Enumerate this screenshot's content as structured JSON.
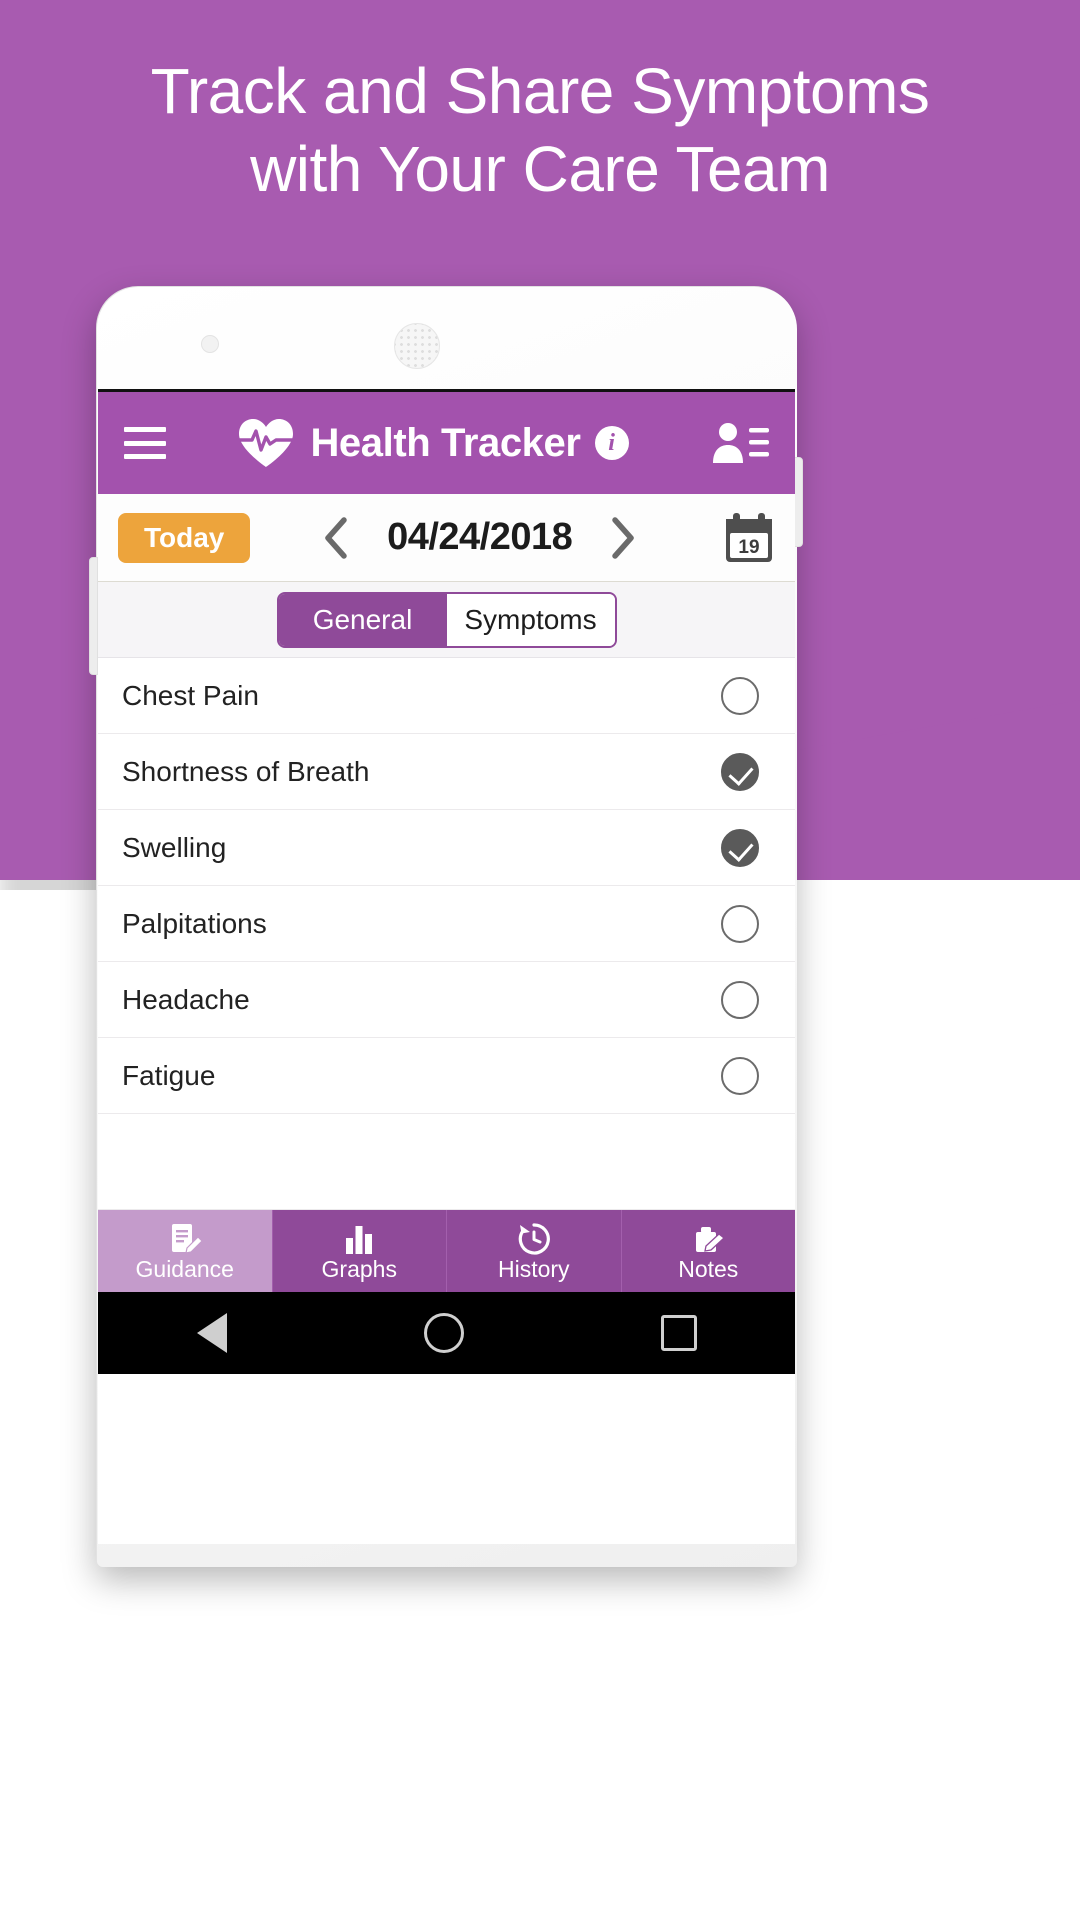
{
  "promo": {
    "headline": "Track and Share Symptoms\nwith Your Care Team",
    "background_color": "#a85bb0",
    "headline_color": "#ffffff"
  },
  "app_bar": {
    "menu_icon": "hamburger-menu-icon",
    "logo_icon": "heart-pulse-icon",
    "title": "Health Tracker",
    "info_icon": "info-icon",
    "info_label": "i",
    "contacts_icon": "contacts-person-list-icon",
    "background_color": "#a352ad"
  },
  "date_bar": {
    "today_label": "Today",
    "today_color": "#eda43c",
    "prev_icon": "chevron-left-icon",
    "date": "04/24/2018",
    "next_icon": "chevron-right-icon",
    "calendar_icon": "calendar-icon",
    "calendar_day": "19"
  },
  "tabs": [
    {
      "label": "General",
      "active": true
    },
    {
      "label": "Symptoms",
      "active": false
    }
  ],
  "symptoms": [
    {
      "label": "Chest Pain",
      "checked": false
    },
    {
      "label": "Shortness of Breath",
      "checked": true
    },
    {
      "label": "Swelling",
      "checked": true
    },
    {
      "label": "Palpitations",
      "checked": false
    },
    {
      "label": "Headache",
      "checked": false
    },
    {
      "label": "Fatigue",
      "checked": false
    }
  ],
  "bottom_nav": [
    {
      "label": "Guidance",
      "icon": "document-pen-icon",
      "active": true
    },
    {
      "label": "Graphs",
      "icon": "bar-chart-icon",
      "active": false
    },
    {
      "label": "History",
      "icon": "clock-history-icon",
      "active": false
    },
    {
      "label": "Notes",
      "icon": "notes-pen-icon",
      "active": false
    }
  ],
  "system_nav": {
    "back": "back-triangle-icon",
    "home": "home-circle-icon",
    "recents": "recents-square-icon"
  },
  "colors": {
    "brand_purple": "#8f4a99",
    "app_bar_purple": "#a352ad",
    "promo_purple": "#a85bb0",
    "accent_orange": "#eda43c",
    "checkbox_checked": "#5a5a5a"
  }
}
